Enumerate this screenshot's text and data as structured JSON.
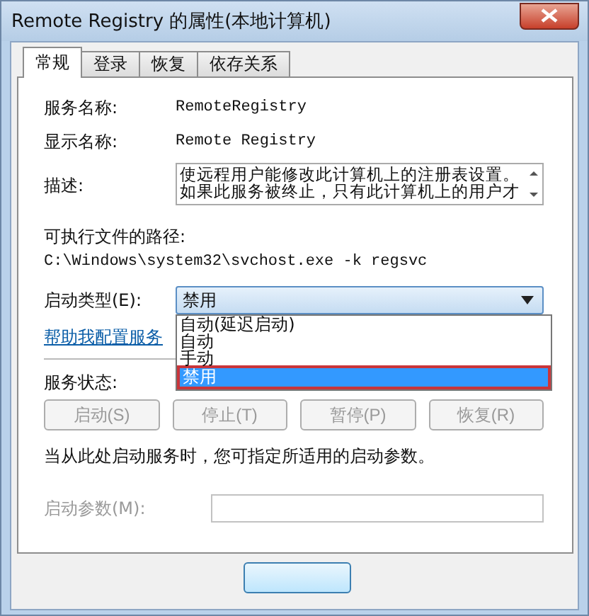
{
  "window": {
    "title": "Remote Registry 的属性(本地计算机)"
  },
  "tabs": [
    {
      "label": "常规",
      "selected": true
    },
    {
      "label": "登录",
      "selected": false
    },
    {
      "label": "恢复",
      "selected": false
    },
    {
      "label": "依存关系",
      "selected": false
    }
  ],
  "service_name": {
    "label": "服务名称:",
    "value": "RemoteRegistry"
  },
  "display_name": {
    "label": "显示名称:",
    "value": "Remote Registry"
  },
  "description": {
    "label": "描述:",
    "lines": [
      "使远程用户能修改此计算机上的注册表设置。",
      "如果此服务被终止，只有此计算机上的用户才"
    ]
  },
  "path": {
    "label": "可执行文件的路径:",
    "value": "C:\\Windows\\system32\\svchost.exe -k regsvc"
  },
  "startup_type": {
    "label": "启动类型(E):",
    "value": "禁用",
    "expanded": true,
    "options": [
      {
        "label": "自动(延迟启动)",
        "selected": false
      },
      {
        "label": "自动",
        "selected": false
      },
      {
        "label": "手动",
        "selected": false
      },
      {
        "label": "禁用",
        "selected": true
      }
    ]
  },
  "help_link": "帮助我配置服务",
  "service_status": {
    "label": "服务状态:"
  },
  "buttons": [
    {
      "label": "启动(S)",
      "disabled": true
    },
    {
      "label": "停止(T)",
      "disabled": true
    },
    {
      "label": "暂停(P)",
      "disabled": true
    },
    {
      "label": "恢复(R)",
      "disabled": true
    }
  ],
  "note": "当从此处启动服务时，您可指定所适用的启动参数。",
  "start_params": {
    "label": "启动参数(M):",
    "disabled": true
  }
}
